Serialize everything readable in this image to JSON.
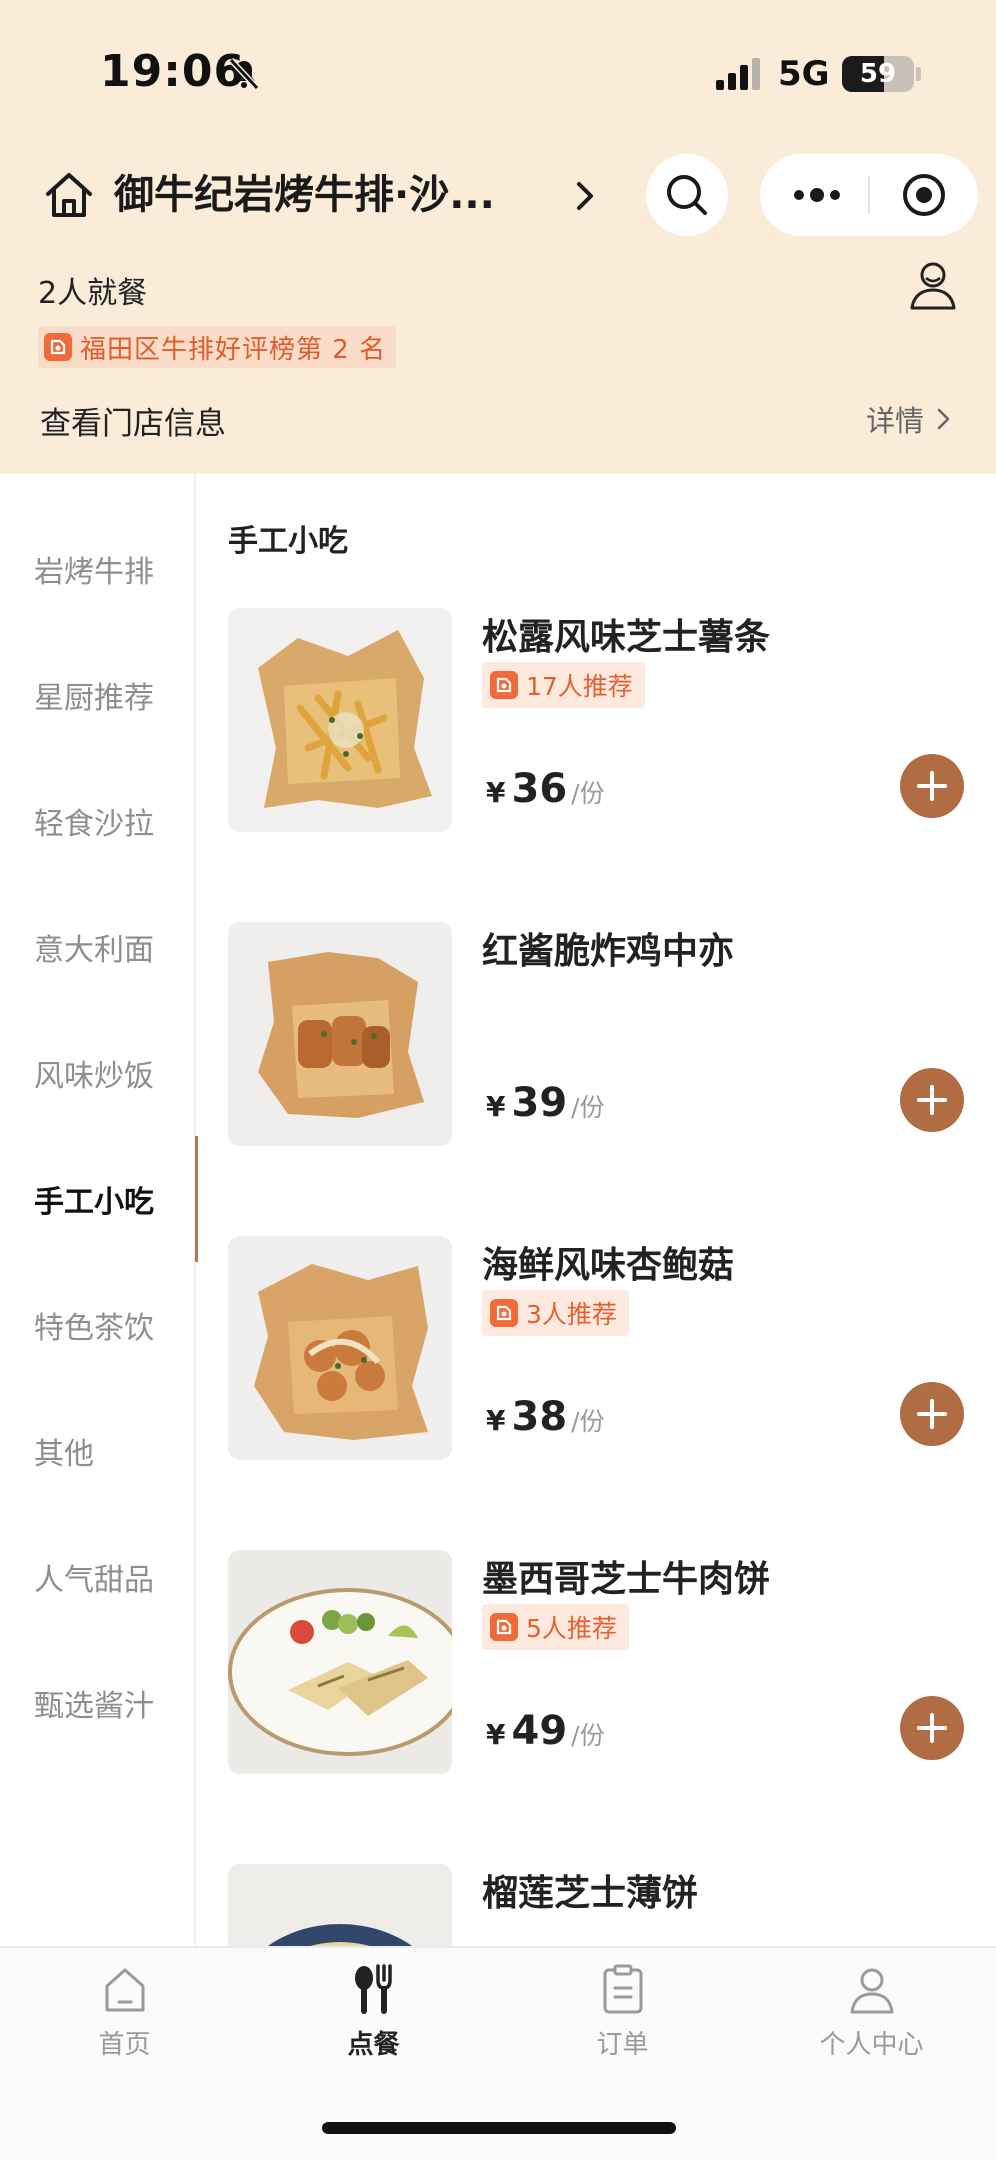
{
  "status": {
    "time": "19:06",
    "network": "5G",
    "battery": "59",
    "battery_level": 0.59
  },
  "header": {
    "store_name": "御牛纪岩烤牛排·沙...",
    "party": "2人就餐",
    "rank": "福田区牛排好评榜第 2 名",
    "info_label": "查看门店信息",
    "detail_label": "详情"
  },
  "categories": [
    {
      "label": "岩烤牛排"
    },
    {
      "label": "星厨推荐"
    },
    {
      "label": "轻食沙拉"
    },
    {
      "label": "意大利面"
    },
    {
      "label": "风味炒饭"
    },
    {
      "label": "手工小吃",
      "active": true
    },
    {
      "label": "特色茶饮"
    },
    {
      "label": "其他"
    },
    {
      "label": "人气甜品"
    },
    {
      "label": "甄选酱汁"
    }
  ],
  "section": {
    "title": "手工小吃"
  },
  "items": [
    {
      "name": "松露风味芝士薯条",
      "recommend": "17人推荐",
      "price": "36",
      "unit": "/份"
    },
    {
      "name": "红酱脆炸鸡中亦",
      "recommend": "",
      "price": "39",
      "unit": "/份"
    },
    {
      "name": "海鲜风味杏鲍菇",
      "recommend": "3人推荐",
      "price": "38",
      "unit": "/份"
    },
    {
      "name": "墨西哥芝士牛肉饼",
      "recommend": "5人推荐",
      "price": "49",
      "unit": "/份"
    },
    {
      "name": "榴莲芝士薄饼",
      "recommend": "",
      "price": "",
      "unit": ""
    }
  ],
  "currency": "¥",
  "tabs": [
    {
      "label": "首页",
      "icon": "home-icon"
    },
    {
      "label": "点餐",
      "icon": "utensils-icon",
      "active": true
    },
    {
      "label": "订单",
      "icon": "order-icon"
    },
    {
      "label": "个人中心",
      "icon": "profile-icon"
    }
  ],
  "colors": {
    "header_bg": "#fbebd9",
    "accent": "#b06d43",
    "badge": "#e4612f"
  }
}
